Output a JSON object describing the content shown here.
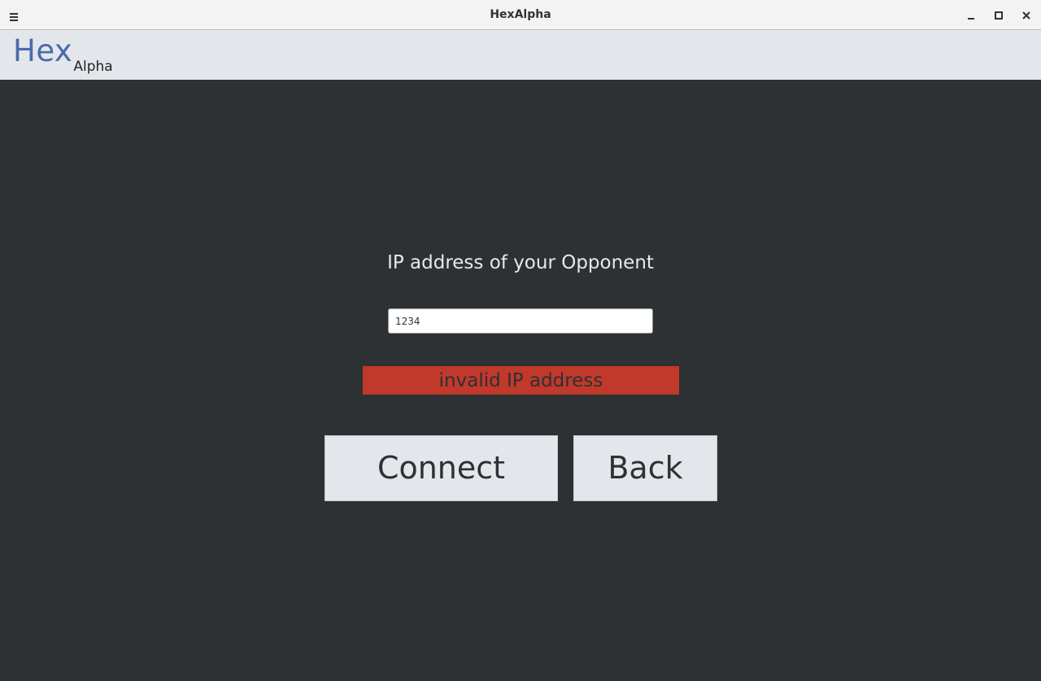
{
  "window": {
    "title": "HexAlpha",
    "icons": {
      "menu": "hamburger-menu-icon",
      "minimize": "minimize-icon",
      "maximize": "maximize-icon",
      "close": "close-icon"
    }
  },
  "header": {
    "logo_main": "Hex",
    "logo_sub": "Alpha"
  },
  "connect_form": {
    "prompt": "IP address of your Opponent",
    "ip_value": "1234",
    "error": "invalid IP address",
    "connect_label": "Connect",
    "back_label": "Back"
  },
  "colors": {
    "accent": "#4a6aab",
    "background": "#2e3133",
    "header_bg": "#e3e7eb",
    "error": "#c0392b"
  }
}
